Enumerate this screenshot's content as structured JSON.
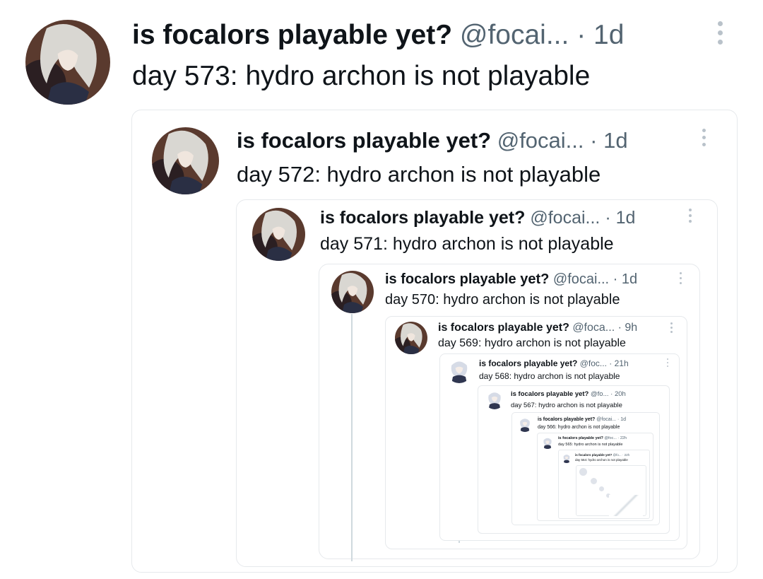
{
  "colors": {
    "name": "#0f1419",
    "meta": "#536471",
    "border": "#e6e9ec",
    "thread_line": "#cfd9de",
    "avatar_dark": "#3b2a25",
    "avatar_hair": "#d9d7d2"
  },
  "icons": {
    "avatar": "focalors-avatar-icon",
    "more": "more-vertical-icon"
  },
  "posts": [
    {
      "name": "is focalors playable yet?",
      "handle": "@focai...",
      "time": "· 1d",
      "text": "day 573: hydro archon is not playable"
    },
    {
      "name": "is focalors playable yet?",
      "handle": "@focai...",
      "time": "· 1d",
      "text": "day 572: hydro archon is not playable"
    },
    {
      "name": "is focalors playable yet?",
      "handle": "@focai...",
      "time": "· 1d",
      "text": "day 571: hydro archon is not playable"
    },
    {
      "name": "is focalors playable yet?",
      "handle": "@focai...",
      "time": "· 1d",
      "text": "day 570: hydro archon is not playable"
    },
    {
      "name": "is focalors playable yet?",
      "handle": "@foca...",
      "time": "· 9h",
      "text": "day 569: hydro archon is not playable"
    },
    {
      "name": "is focalors playable yet?",
      "handle": "@foc...",
      "time": "· 21h",
      "text": "day 568: hydro archon is not playable"
    },
    {
      "name": "is focalors playable yet?",
      "handle": "@fo...",
      "time": "· 20h",
      "text": "day 567: hydro archon is not playable"
    },
    {
      "name": "is focalors playable yet?",
      "handle": "@focai...",
      "time": "· 1d",
      "text": "day 566: hydro archon is not playable"
    },
    {
      "name": "is focalors playable yet?",
      "handle": "@foc...",
      "time": "· 22h",
      "text": "day 565: hydro archon is not playable"
    },
    {
      "name": "is focalors playable yet?",
      "handle": "@fo...",
      "time": "· 22h",
      "text": "day 564: hydro archon is not playable"
    }
  ]
}
